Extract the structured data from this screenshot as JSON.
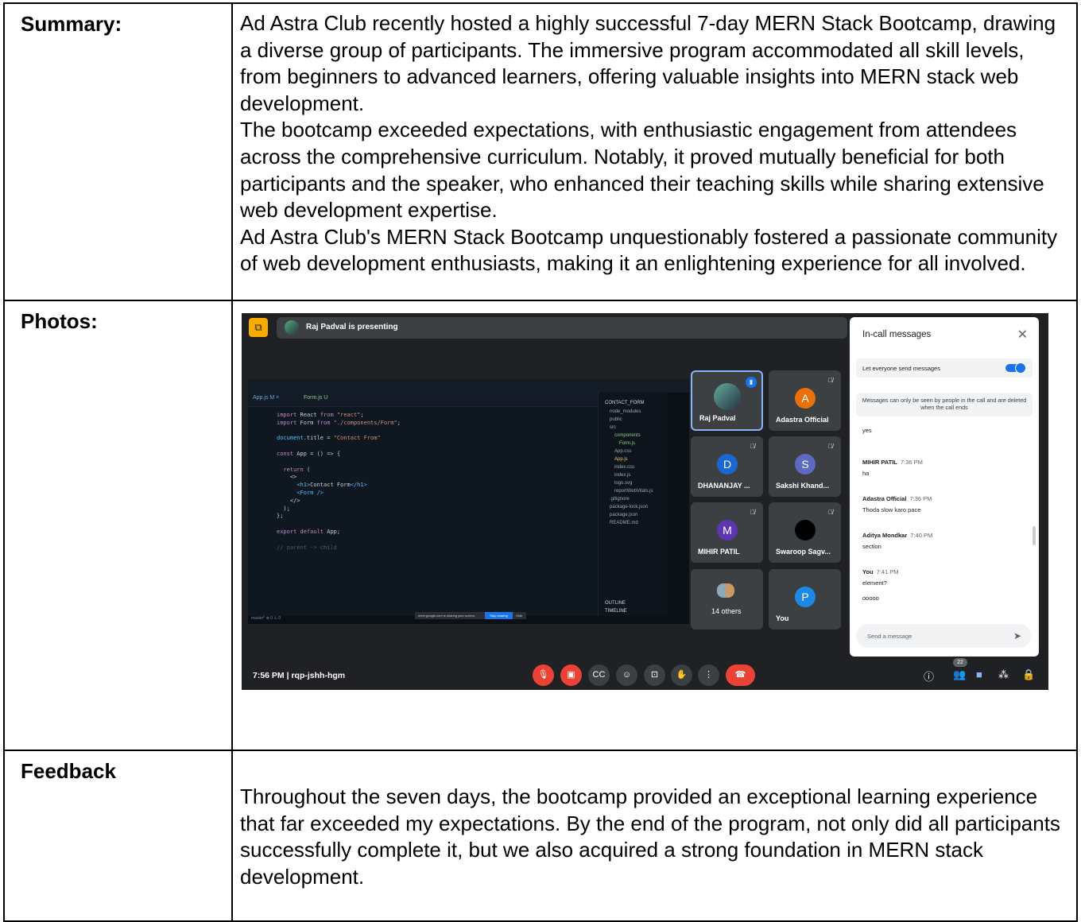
{
  "rows": {
    "summary": {
      "label": "Summary:",
      "paragraphs": [
        "Ad Astra Club recently hosted a highly successful 7-day MERN Stack Bootcamp, drawing a diverse group of participants. The immersive program accommodated all skill levels, from beginners to advanced learners, offering valuable insights into MERN stack web development.",
        "The bootcamp exceeded expectations, with enthusiastic engagement from attendees across the comprehensive curriculum. Notably, it proved mutually beneficial for both participants and the speaker, who enhanced their teaching skills while sharing extensive web development expertise.",
        "Ad Astra Club's MERN Stack Bootcamp unquestionably fostered a passionate community of web development enthusiasts, making it an enlightening experience for all involved."
      ]
    },
    "photos": {
      "label": "Photos:"
    },
    "feedback": {
      "label": "Feedback",
      "text": "Throughout the seven days, the bootcamp provided an exceptional learning experience that far exceeded my expectations. By the end of the program, not only did all participants successfully complete it, but we also acquired a strong foundation in MERN stack development."
    }
  },
  "meet": {
    "presenting": "Raj Padval is presenting",
    "time_code": "7:56 PM  |  rqp-jshh-hgm",
    "participant_count": "22",
    "tiles": [
      {
        "name": "Raj Padval",
        "initial": ""
      },
      {
        "name": "Adastra Official",
        "initial": "A"
      },
      {
        "name": "DHANANJAY ...",
        "initial": "D"
      },
      {
        "name": "Sakshi Khand...",
        "initial": "S"
      },
      {
        "name": "MIHIR PATIL",
        "initial": "M"
      },
      {
        "name": "Swaroop Sagv...",
        "initial": ""
      },
      {
        "name": "14 others",
        "initial": ""
      },
      {
        "name": "You",
        "initial": "P"
      }
    ],
    "chat": {
      "title": "In-call messages",
      "toggle_label": "Let everyone send messages",
      "note": "Messages can only be seen by people in the call and are deleted when the call ends",
      "partial_message": "yes",
      "messages": [
        {
          "sender": "MIHIR PATIL",
          "time": "7:36 PM",
          "text": "ha"
        },
        {
          "sender": "Adastra Official",
          "time": "7:36 PM",
          "text": "Thoda slow karo pace"
        },
        {
          "sender": "Aditya Mondkar",
          "time": "7:40 PM",
          "text": "section"
        },
        {
          "sender": "You",
          "time": "7:41 PM",
          "text": "element?"
        }
      ],
      "extra_text": "ooooo",
      "input_placeholder": "Send a message"
    },
    "vscode": {
      "tab1": "App.js  M  ×",
      "tab2": "Form.js  U",
      "explorer_title": "CONTACT_FORM",
      "files": [
        "node_modules",
        "public",
        "src",
        "components",
        "Form.js",
        "App.css",
        "App.js",
        "index.css",
        "index.js",
        "logo.svg",
        "reportWebVitals.js",
        ".gitignore",
        "package-lock.json",
        "package.json",
        "README.md"
      ],
      "outline": "OUTLINE",
      "timeline": "TIMELINE",
      "share_text": "meet.google.com is sharing your screen.",
      "stop_sharing": "Stop sharing",
      "hide": "Hide",
      "status": "master*  ⊗ 0 ⚠ 0"
    }
  }
}
